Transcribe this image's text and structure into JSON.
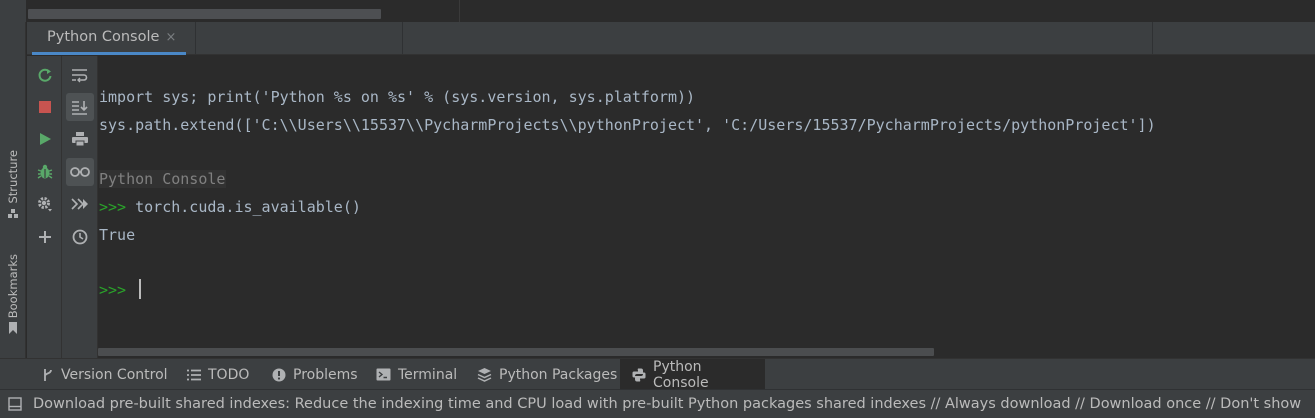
{
  "tool_window": {
    "tab_label": "Python Console",
    "close_glyph": "×"
  },
  "side_stripe": {
    "structure_label": "Structure",
    "bookmarks_label": "Bookmarks"
  },
  "toolbar": {
    "rerun_icon": "rerun-icon",
    "stop_icon": "stop-icon",
    "run_icon": "run-icon",
    "debug_icon": "debug-icon",
    "settings_icon": "settings-icon",
    "add_icon": "add-icon",
    "soft_wrap_icon": "soft-wrap-icon",
    "scroll_end_icon": "scroll-to-end-icon",
    "print_icon": "print-icon",
    "variables_icon": "show-variables-icon",
    "execute_icon": "execute-icon",
    "history_icon": "history-icon"
  },
  "console": {
    "line1": "import sys; print('Python %s on %s' % (sys.version, sys.platform))",
    "line2": "sys.path.extend(['C:\\\\Users\\\\15537\\\\PycharmProjects\\\\pythonProject', 'C:/Users/15537/PycharmProjects/pythonProject'])",
    "banner": "Python Console",
    "prompt": ">>>",
    "command": " torch.cuda.is_available()",
    "output": "True",
    "prompt_empty": ">>>"
  },
  "bottom_tabs": [
    {
      "label": "Version Control",
      "icon": "git-branch-icon"
    },
    {
      "label": "TODO",
      "icon": "list-icon"
    },
    {
      "label": "Problems",
      "icon": "problems-icon"
    },
    {
      "label": "Terminal",
      "icon": "terminal-icon"
    },
    {
      "label": "Python Packages",
      "icon": "packages-icon"
    },
    {
      "label": "Python Console",
      "icon": "python-icon",
      "selected": true
    }
  ],
  "status_bar": {
    "message": "Download pre-built shared indexes: Reduce the indexing time and CPU load with pre-built Python packages shared indexes // Always download // Download once // Don't show"
  },
  "colors": {
    "background": "#2b2b2b",
    "panel": "#3c3f41",
    "accent": "#4a88c7",
    "prompt_green": "#2aa32a",
    "text": "#a9b7c6"
  }
}
